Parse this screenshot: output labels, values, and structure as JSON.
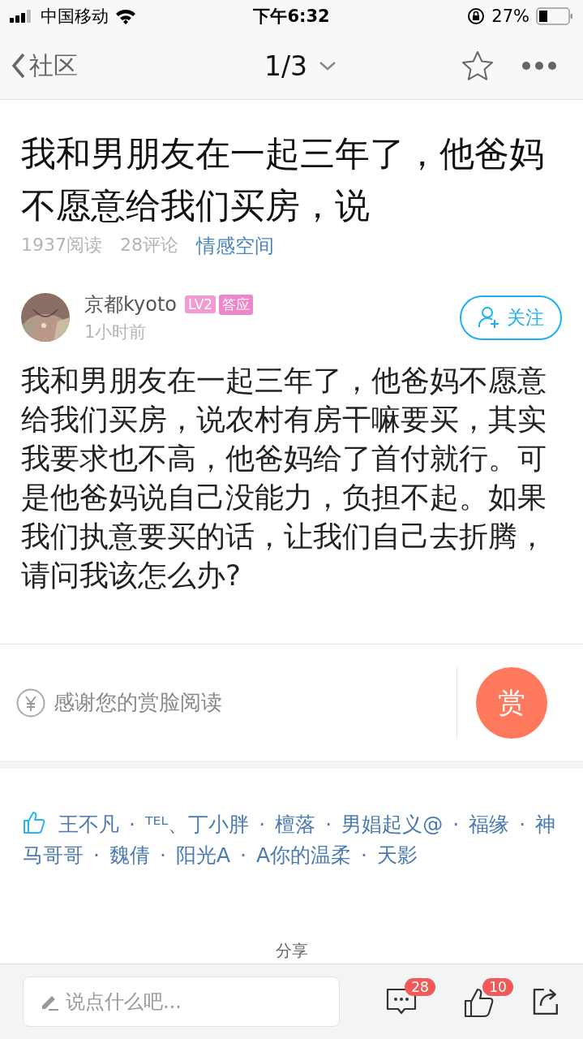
{
  "status_bar": {
    "carrier": "中国移动",
    "time": "下午6:32",
    "battery": "27%"
  },
  "nav": {
    "back": "社区",
    "pager": "1/3"
  },
  "post": {
    "title": "我和男朋友在一起三年了，他爸妈不愿意给我们买房，说",
    "reads": "1937阅读",
    "comments": "28评论",
    "category": "情感空间",
    "author": {
      "name": "京都kyoto",
      "badges": [
        {
          "label": "LV2",
          "color": "#f39ad3"
        },
        {
          "label": "答应",
          "color": "#ee86cb"
        }
      ],
      "time": "1小时前",
      "follow": "关注"
    },
    "body": "我和男朋友在一起三年了，他爸妈不愿意给我们买房，说农村有房干嘛要买，其实我要求也不高，他爸妈给了首付就行。可是他爸妈说自己没能力，负担不起。如果我们执意要买的话，让我们自己去折腾，请问我该怎么办?"
  },
  "reward": {
    "text": "感谢您的赏脸阅读",
    "button": "赏"
  },
  "likes": {
    "separator": "·",
    "names": [
      "王不凡",
      "ᵀᴱᴸ、丁小胖",
      "檀落",
      "男娼起义@",
      "福缘",
      "神马哥哥",
      "魏倩",
      "阳光A",
      "A你的温柔",
      "天影"
    ]
  },
  "share_label": "分享",
  "bottom_bar": {
    "placeholder": "说点什么吧...",
    "comment_count": "28",
    "like_count": "10"
  }
}
